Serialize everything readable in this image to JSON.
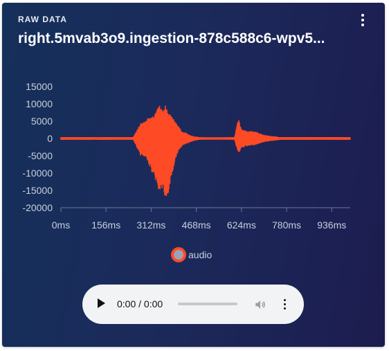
{
  "header": {
    "label": "RAW DATA",
    "title": "right.5mvab3o9.ingestion-878c588c6-wpv5..."
  },
  "icons": {
    "menu": "more-vertical-icon",
    "play": "play-icon",
    "volume": "volume-icon",
    "player_menu": "more-vertical-icon"
  },
  "colors": {
    "series": "#ff4a26",
    "legend_fill": "#9aa3b8",
    "card_bg_start": "#15305a",
    "card_bg_end": "#1d1c4f",
    "axis_text": "#c9cfdd"
  },
  "chart_data": {
    "type": "line",
    "title": "",
    "xlabel": "",
    "ylabel": "",
    "x_unit": "ms",
    "xlim": [
      0,
      1000
    ],
    "ylim": [
      -20000,
      15000
    ],
    "y_ticks": [
      15000,
      10000,
      5000,
      0,
      -5000,
      -10000,
      -15000,
      -20000
    ],
    "y_tick_labels": [
      "15000",
      "10000",
      "5000",
      "0",
      "-5000",
      "-10000",
      "-15000",
      "-20000"
    ],
    "x_ticks": [
      0,
      156,
      312,
      468,
      624,
      780,
      936
    ],
    "x_tick_labels": [
      "0ms",
      "156ms",
      "312ms",
      "468ms",
      "624ms",
      "780ms",
      "936ms"
    ],
    "grid": false,
    "legend_position": "bottom-center",
    "series": [
      {
        "name": "audio",
        "envelope_time_ms": [
          0,
          250,
          265,
          275,
          290,
          300,
          315,
          325,
          335,
          345,
          355,
          360,
          370,
          380,
          390,
          400,
          410,
          420,
          430,
          445,
          460,
          480,
          500,
          540,
          600,
          610,
          615,
          622,
          630,
          645,
          660,
          680,
          700,
          720,
          740,
          760,
          1000
        ],
        "envelope_max": [
          400,
          400,
          2800,
          4500,
          5200,
          5800,
          6500,
          7500,
          10500,
          9000,
          8500,
          10000,
          8000,
          6500,
          6000,
          4500,
          3200,
          2000,
          1800,
          1000,
          600,
          400,
          300,
          300,
          400,
          4500,
          5600,
          3000,
          2500,
          2100,
          2300,
          1800,
          1100,
          800,
          600,
          400,
          400
        ],
        "envelope_min": [
          -400,
          -400,
          -3000,
          -5000,
          -5600,
          -6500,
          -10000,
          -11500,
          -15000,
          -15500,
          -14000,
          -19500,
          -17000,
          -12000,
          -8500,
          -4800,
          -3200,
          -2200,
          -1700,
          -1200,
          -700,
          -400,
          -300,
          -300,
          -400,
          -3500,
          -4600,
          -3000,
          -2600,
          -2300,
          -2100,
          -1700,
          -1100,
          -800,
          -600,
          -400,
          -400
        ]
      }
    ]
  },
  "legend": {
    "items": [
      {
        "label": "audio"
      }
    ]
  },
  "player": {
    "time": "0:00 / 0:00",
    "progress": 0
  }
}
